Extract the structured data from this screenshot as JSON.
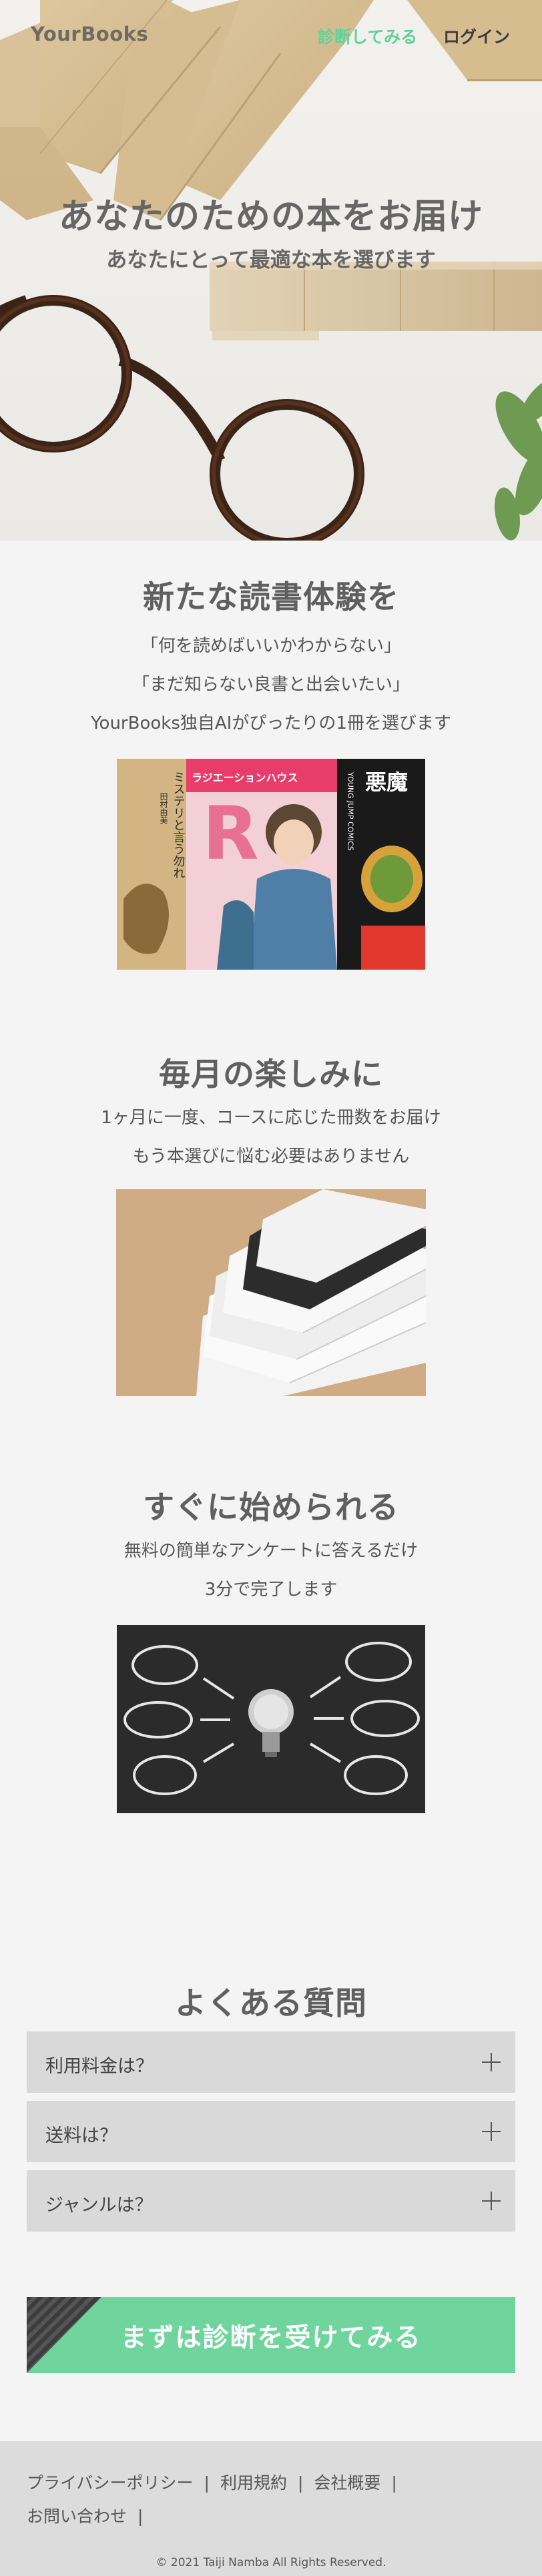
{
  "header": {
    "logo": "YourBooks",
    "try_link": "診断してみる",
    "login_link": "ログイン"
  },
  "hero": {
    "title": "あなたのための本をお届け",
    "subtitle": "あなたにとって最適な本を選びます"
  },
  "features": [
    {
      "title": "新たな読書体験を",
      "lines": [
        "「何を読めばいいかわからない」",
        "「まだ知らない良書と出会いたい」",
        "YourBooks独自AIがぴったりの1冊を選びます"
      ],
      "image_texts": [
        "ミステリと言う勿れ",
        "田村由美",
        "ラジエーションハウス",
        "YOUNG JUMP COMICS",
        "悪魔"
      ]
    },
    {
      "title": "毎月の楽しみに",
      "lines": [
        "1ヶ月に一度、コースに応じた冊数をお届け",
        "もう本選びに悩む必要はありません"
      ]
    },
    {
      "title": "すぐに始められる",
      "lines": [
        "無料の簡単なアンケートに答えるだけ",
        "3分で完了します"
      ]
    }
  ],
  "faq": {
    "title": "よくある質問",
    "items": [
      "利用料金は？",
      "送料は？",
      "ジャンルは？"
    ]
  },
  "cta": {
    "label": "まずは診断を受けてみる"
  },
  "footer": {
    "links": [
      "プライバシーポリシー",
      "利用規約",
      "会社概要",
      "お問い合わせ"
    ],
    "copyright": "© 2021 Taiji Namba All Rights Reserved."
  },
  "colors": {
    "accent": "#6fd59d",
    "nav_accent": "#5fd39a",
    "background": "#f4f4f4",
    "faq_bg": "#d9d9d9",
    "footer_bg": "#dcdcdc"
  }
}
